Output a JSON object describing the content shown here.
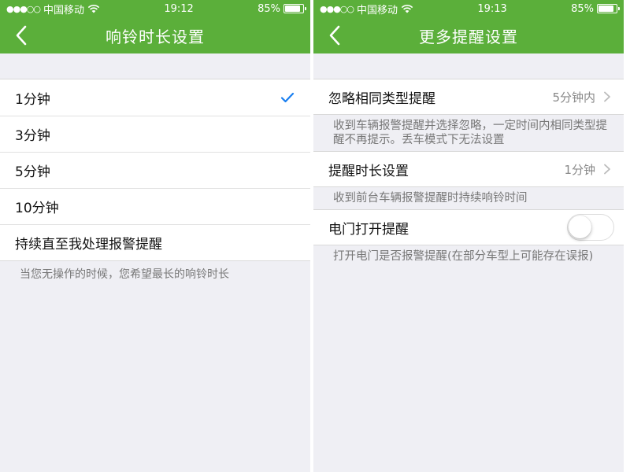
{
  "colors": {
    "accent": "#5baf3a",
    "check": "#1a7ff0",
    "background": "#efeff4"
  },
  "left": {
    "status": {
      "signal": "●●●○○",
      "carrier": "中国移动",
      "time": "19:12",
      "battery": "85%",
      "battery_level": 0.85
    },
    "nav": {
      "title": "响铃时长设置"
    },
    "options": [
      {
        "label": "1分钟",
        "selected": true
      },
      {
        "label": "3分钟",
        "selected": false
      },
      {
        "label": "5分钟",
        "selected": false
      },
      {
        "label": "10分钟",
        "selected": false
      },
      {
        "label": "持续直至我处理报警提醒",
        "selected": false
      }
    ],
    "footnote": "当您无操作的时候，您希望最长的响铃时长"
  },
  "right": {
    "status": {
      "signal": "●●●○○",
      "carrier": "中国移动",
      "time": "19:13",
      "battery": "85%",
      "battery_level": 0.85
    },
    "nav": {
      "title": "更多提醒设置"
    },
    "ignore": {
      "label": "忽略相同类型提醒",
      "value": "5分钟内",
      "desc": "收到车辆报警提醒并选择忽略，一定时间内相同类型提醒不再提示。丢车模式下无法设置"
    },
    "duration": {
      "label": "提醒时长设置",
      "value": "1分钟",
      "desc": "收到前台车辆报警提醒时持续响铃时间"
    },
    "door": {
      "label": "电门打开提醒",
      "toggle_on": false,
      "desc": "打开电门是否报警提醒(在部分车型上可能存在误报)"
    }
  }
}
